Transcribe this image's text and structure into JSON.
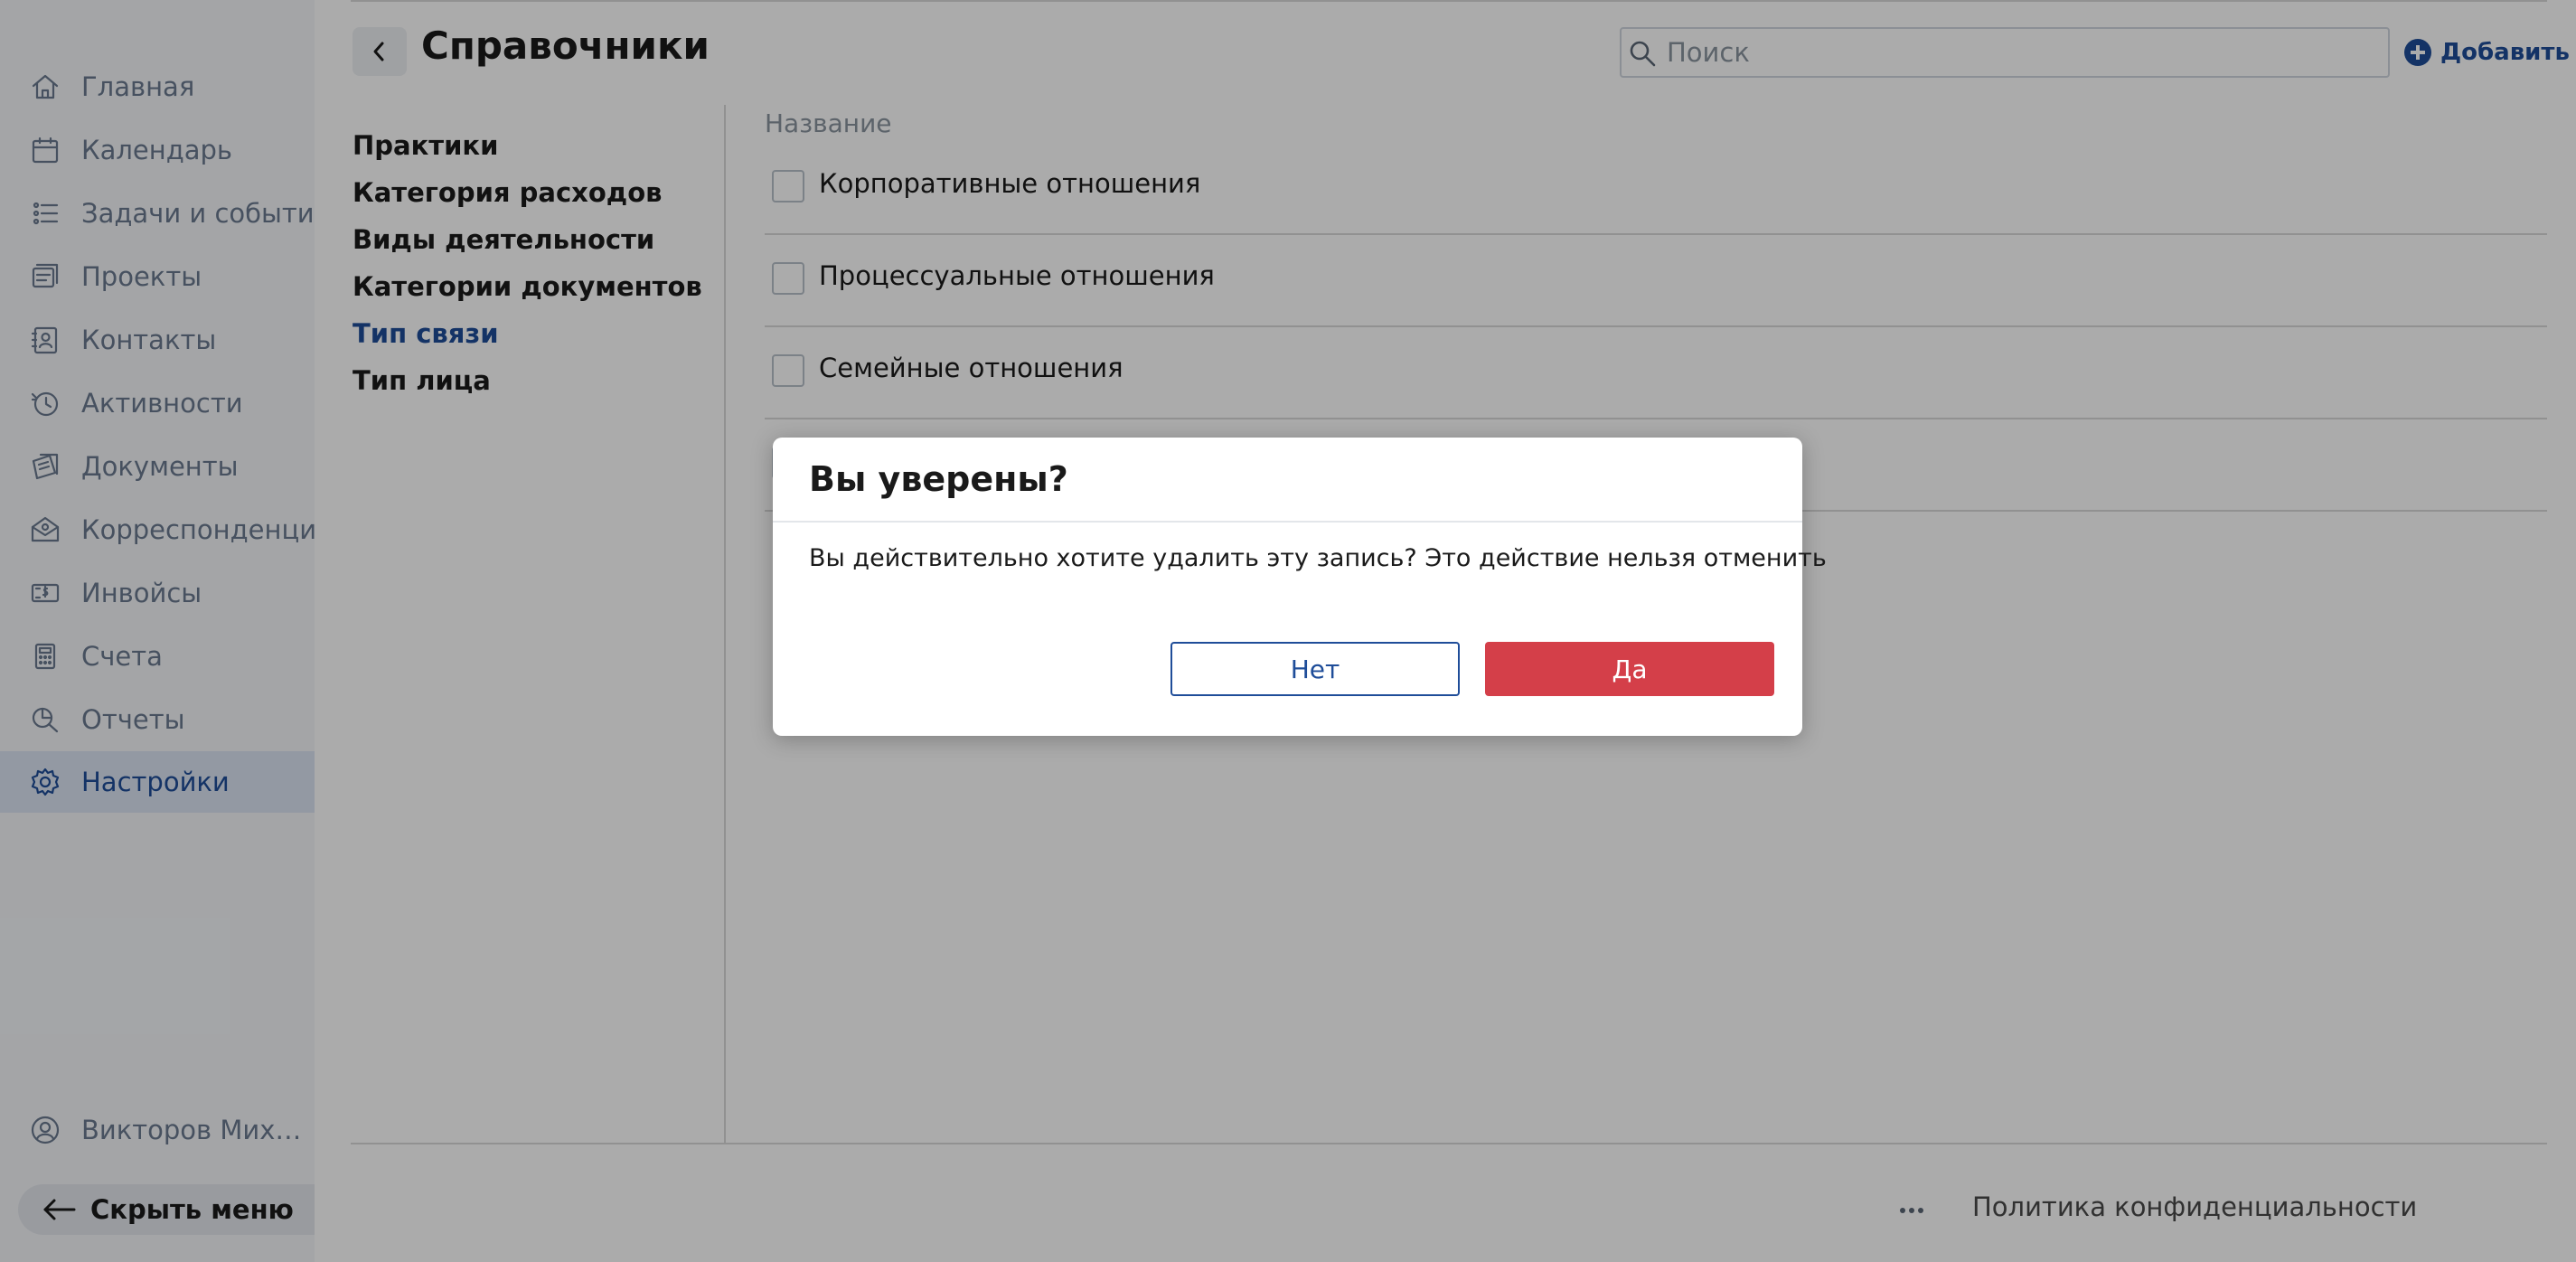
{
  "sidebar": {
    "items": [
      {
        "label": "Главная",
        "icon": "home-icon"
      },
      {
        "label": "Календарь",
        "icon": "calendar-icon"
      },
      {
        "label": "Задачи и события",
        "icon": "tasks-icon"
      },
      {
        "label": "Проекты",
        "icon": "projects-icon"
      },
      {
        "label": "Контакты",
        "icon": "contacts-icon"
      },
      {
        "label": "Активности",
        "icon": "activity-icon"
      },
      {
        "label": "Документы",
        "icon": "documents-icon"
      },
      {
        "label": "Корреспонденция",
        "icon": "correspondence-icon"
      },
      {
        "label": "Инвойсы",
        "icon": "invoices-icon"
      },
      {
        "label": "Счета",
        "icon": "accounts-icon"
      },
      {
        "label": "Отчеты",
        "icon": "reports-icon"
      },
      {
        "label": "Настройки",
        "icon": "settings-icon",
        "active": true
      }
    ],
    "user": {
      "label": "Викторов Михаил...",
      "icon": "user-icon"
    },
    "hide_menu": "Скрыть меню"
  },
  "header": {
    "title": "Справочники",
    "search_placeholder": "Поиск",
    "search_value": "",
    "add_label": "Добавить"
  },
  "references": {
    "items": [
      {
        "label": "Практики"
      },
      {
        "label": "Категория расходов"
      },
      {
        "label": "Виды деятельности"
      },
      {
        "label": "Категории документов"
      },
      {
        "label": "Тип связи",
        "active": true
      },
      {
        "label": "Тип лица"
      }
    ]
  },
  "table": {
    "column_header": "Название",
    "rows": [
      {
        "label": "Корпоративные отношения",
        "checked": false
      },
      {
        "label": "Процессуальные отношения",
        "checked": false
      },
      {
        "label": "Семейные отношения",
        "checked": false
      },
      {
        "label": "",
        "checked": false
      }
    ]
  },
  "footer": {
    "more_icon": "more-horizontal-icon",
    "policy": "Политика конфиденциальности"
  },
  "modal": {
    "title": "Вы уверены?",
    "text": "Вы действительно хотите удалить эту запись? Это действие нельзя отменить",
    "no_label": "Нет",
    "yes_label": "Да",
    "yes_color": "#d43f49"
  },
  "colors": {
    "accent": "#1f4d99",
    "danger": "#d43f49"
  }
}
